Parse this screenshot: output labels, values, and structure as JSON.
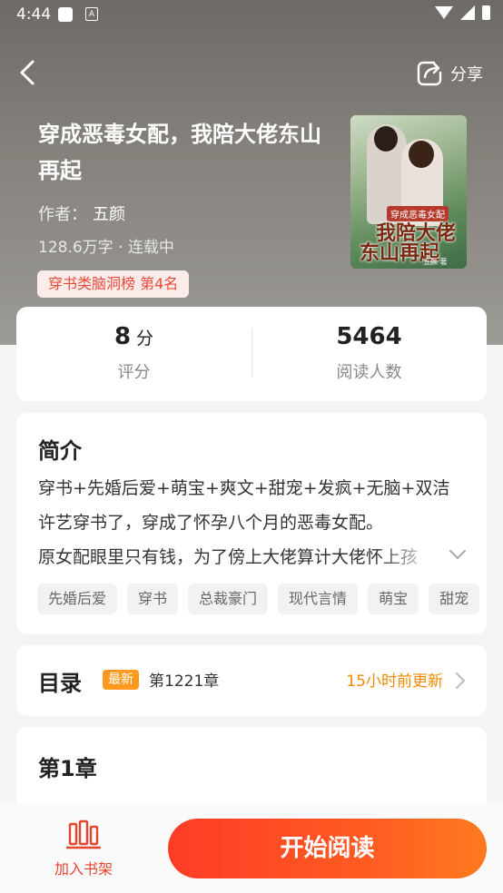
{
  "status_bar": {
    "time": "4:44",
    "notification_icon": "app-notification-icon",
    "a_icon_letter": "A"
  },
  "nav": {
    "back_icon": "chevron-left-icon",
    "share_icon": "share-icon",
    "share_label": "分享"
  },
  "book": {
    "title": "穿成恶毒女配，我陪大佬东山再起",
    "author_label": "作者：",
    "author_name": "五颜",
    "meta": "128.6万字 · 连载中",
    "rank": "穿书类脑洞榜  第4名",
    "cover": {
      "subtitle": "穿成恶毒女配",
      "title_line1": "我陪大佬",
      "title_line2": "东山再起",
      "author": "五颜 著"
    }
  },
  "stats": {
    "score_value": "8",
    "score_unit": "分",
    "score_label": "评分",
    "readers_value": "5464",
    "readers_label": "阅读人数"
  },
  "intro": {
    "title": "简介",
    "lines": [
      "穿书+先婚后爱+萌宝+爽文+甜宠+发疯+无脑+双洁",
      "许艺穿书了，穿成了怀孕八个月的恶毒女配。",
      "原女配眼里只有钱，为了傍上大佬算计大佬怀上孩"
    ],
    "expand_icon": "chevron-down-icon",
    "tags": [
      "先婚后爱",
      "穿书",
      "总裁豪门",
      "现代言情",
      "萌宝",
      "甜宠"
    ]
  },
  "toc": {
    "title": "目录",
    "latest_badge": "最新",
    "latest_chapter": "第1221章",
    "update_text": "15小时前更新",
    "arrow_icon": "chevron-right-icon"
  },
  "chapter": {
    "title": "第1章"
  },
  "bottom_bar": {
    "shelf_icon": "bookshelf-icon",
    "shelf_label": "加入书架",
    "read_button": "开始阅读"
  },
  "colors": {
    "accent": "#ff4a24",
    "orange": "#f08a00",
    "rank_text": "#e84a3a",
    "header_bg": "#7c7974"
  }
}
